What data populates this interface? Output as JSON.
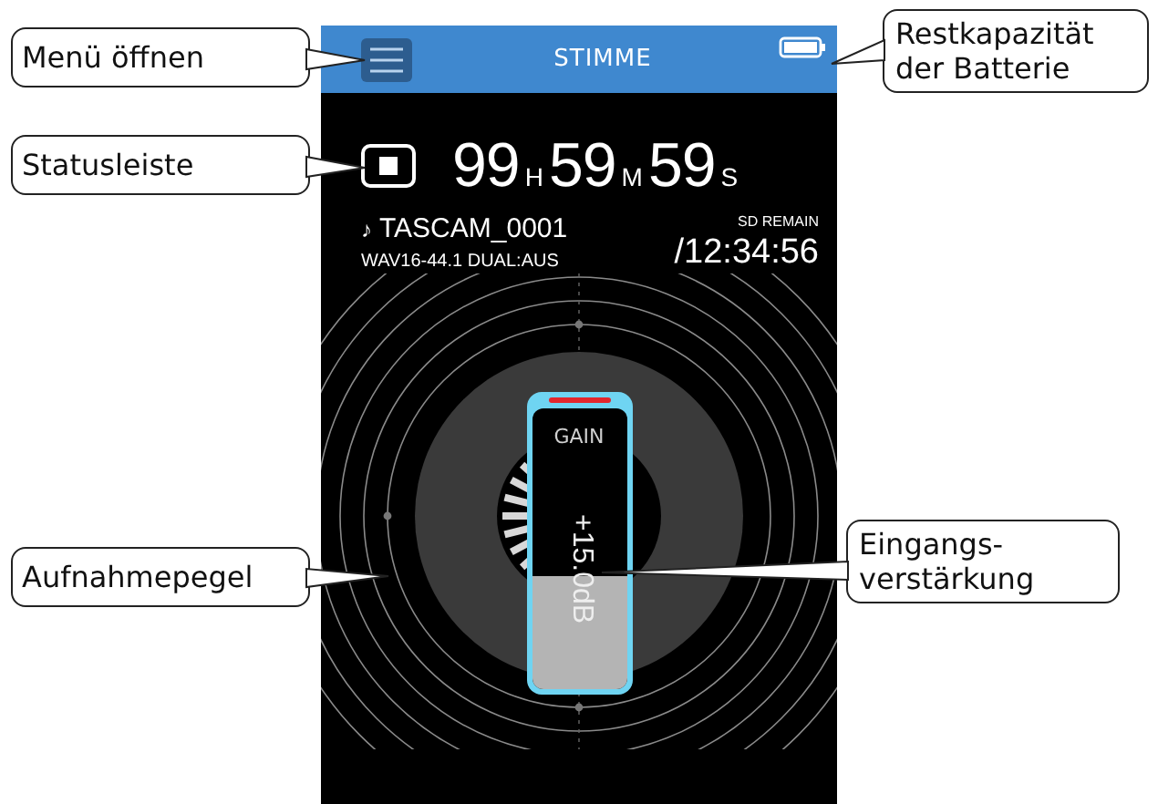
{
  "header": {
    "title": "STIMME"
  },
  "transport": {
    "recording": false,
    "hours": "99",
    "hours_unit": "H",
    "minutes": "59",
    "minutes_unit": "M",
    "seconds": "59",
    "seconds_unit": "S"
  },
  "file": {
    "icon": "♪",
    "name": "TASCAM_0001",
    "format": "WAV16-44.1 DUAL:AUS"
  },
  "remain": {
    "label": "SD REMAIN",
    "time": "/12:34:56"
  },
  "gain": {
    "label": "GAIN",
    "reading": "+15.0dB",
    "level": 0.4
  },
  "callouts": [
    {
      "text": "Menü öffnen"
    },
    {
      "text": "Statusleiste"
    },
    {
      "text": "Restkapazität der Batterie"
    },
    {
      "text": "Aufnahmepegel"
    },
    {
      "text": "Eingangs-verstärkung"
    }
  ]
}
